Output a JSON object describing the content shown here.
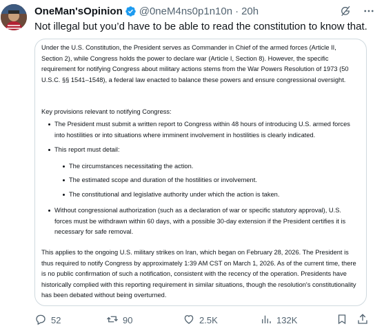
{
  "author": {
    "display_name": "OneMan'sOpinion",
    "handle": "@0neM4ns0p1n10n",
    "separator": "·",
    "time": "20h",
    "verified": true,
    "verified_color": "#1d9bf0"
  },
  "tweet": {
    "text": "Not illegal but you’d have to be able to read the constitution to know that."
  },
  "attachment": {
    "paragraph_1": "Under the U.S. Constitution, the President serves as Commander in Chief of the armed forces (Article II, Section 2), while Congress holds the power to declare war (Article I, Section 8). However, the specific requirement for notifying Congress about military actions stems from the War Powers Resolution of 1973 (50 U.S.C. §§ 1541–1548), a federal law enacted to balance these powers and ensure congressional oversight.",
    "paragraph_2": "Key provisions relevant to notifying Congress:",
    "bullet_1": "The President must submit a written report to Congress within 48 hours of introducing U.S. armed forces into hostilities or into situations where imminent involvement in hostilities is clearly indicated.",
    "bullet_2": "This report must detail:",
    "sub_bullet_1": "The circumstances necessitating the action.",
    "sub_bullet_2": "The estimated scope and duration of the hostilities or involvement.",
    "sub_bullet_3": "The constitutional and legislative authority under which the action is taken.",
    "bullet_3": "Without congressional authorization (such as a declaration of war or specific statutory approval), U.S. forces must be withdrawn within 60 days, with a possible 30-day extension if the President certifies it is necessary for safe removal.",
    "paragraph_3": "This applies to the ongoing U.S. military strikes on Iran, which began on February 28, 2026. The President is thus required to notify Congress by approximately 1:39 AM CST on March 1, 2026. As of the current time, there is no public confirmation of such a notification, consistent with the recency of the operation. Presidents have historically complied with this reporting requirement in similar situations, though the resolution's constitutionality has been debated without being overturned."
  },
  "actions": {
    "replies": "52",
    "reposts": "90",
    "likes": "2.5K",
    "views": "132K"
  },
  "icons": {
    "reply": "reply-icon",
    "repost": "repost-icon",
    "like": "heart-icon",
    "views": "views-icon",
    "bookmark": "bookmark-icon",
    "share": "share-icon",
    "grok": "grok-icon",
    "more": "more-icon"
  },
  "colors": {
    "text": "#0f1419",
    "secondary": "#536471",
    "border": "#cfd9de"
  }
}
